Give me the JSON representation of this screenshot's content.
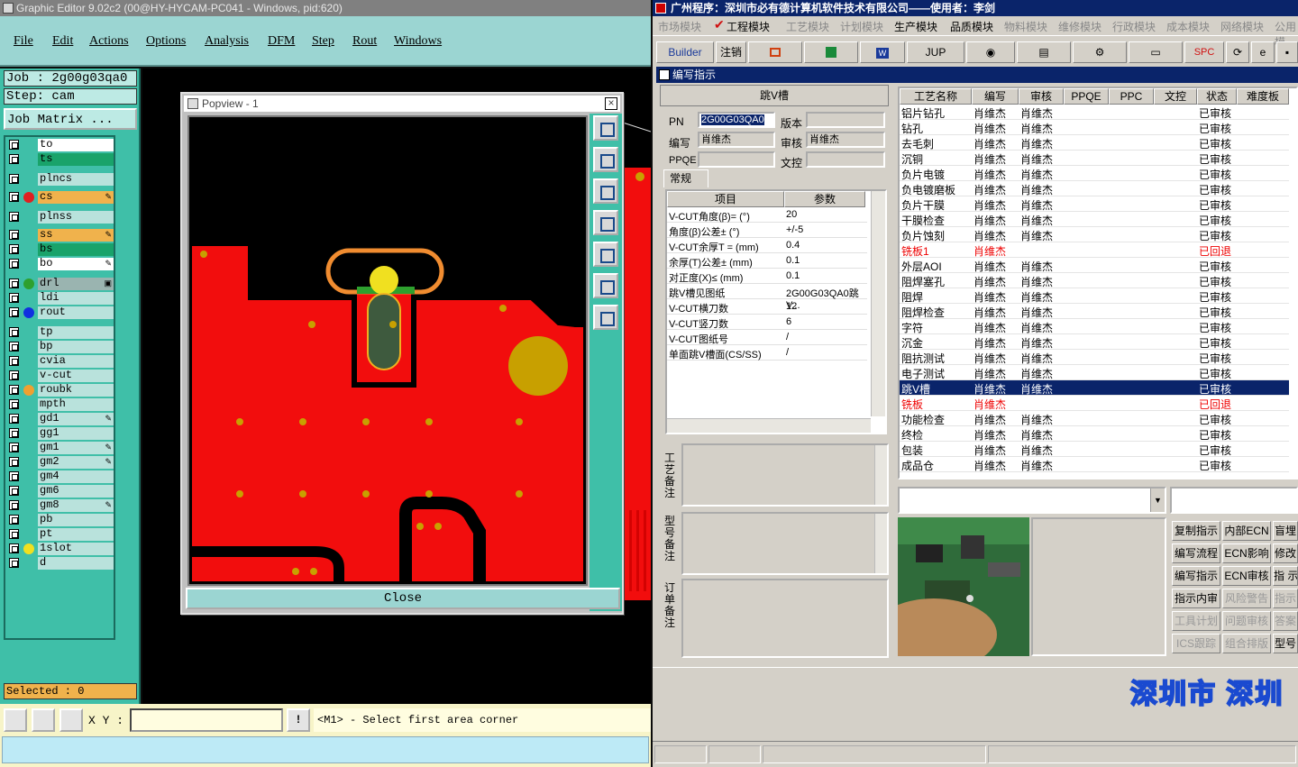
{
  "ge": {
    "title": "Graphic Editor 9.02c2 (00@HY-HYCAM-PC041 - Windows, pid:620)",
    "menu": [
      "File",
      "Edit",
      "Actions",
      "Options",
      "Analysis",
      "DFM",
      "Step",
      "Rout",
      "Windows"
    ],
    "job": "Job : 2g00g03qa0",
    "step": "Step: cam",
    "job_matrix": "Job Matrix ...",
    "layers": [
      {
        "name": "to",
        "bg": "#ffffff",
        "dot": ""
      },
      {
        "name": "ts",
        "bg": "#19a36a",
        "dot": ""
      },
      {
        "name": "plncs",
        "bg": "#b9e2dc",
        "dot": ""
      },
      {
        "name": "cs",
        "bg": "#f0b24c",
        "dot": "#e02020",
        "mark": "✎"
      },
      {
        "name": "plnss",
        "bg": "#b9e2dc",
        "dot": ""
      },
      {
        "name": "ss",
        "bg": "#f0b24c",
        "dot": "",
        "mark": "✎"
      },
      {
        "name": "bs",
        "bg": "#19a36a",
        "dot": ""
      },
      {
        "name": "bo",
        "bg": "#ffffff",
        "dot": "",
        "mark": "✎"
      },
      {
        "name": "drl",
        "bg": "#9ab4b0",
        "dot": "#2ea02e",
        "mark": "▣"
      },
      {
        "name": "ldi",
        "bg": "#b9e2dc",
        "dot": ""
      },
      {
        "name": "rout",
        "bg": "#b9e2dc",
        "dot": "#1030e0"
      },
      {
        "name": "tp",
        "bg": "#b9e2dc",
        "dot": ""
      },
      {
        "name": "bp",
        "bg": "#b9e2dc",
        "dot": ""
      },
      {
        "name": "cvia",
        "bg": "#b9e2dc",
        "dot": ""
      },
      {
        "name": "v-cut",
        "bg": "#b9e2dc",
        "dot": ""
      },
      {
        "name": "roubk",
        "bg": "#b9e2dc",
        "dot": "#f0a030"
      },
      {
        "name": "mpth",
        "bg": "#b9e2dc",
        "dot": ""
      },
      {
        "name": "gd1",
        "bg": "#b9e2dc",
        "dot": "",
        "mark": "✎"
      },
      {
        "name": "gg1",
        "bg": "#b9e2dc",
        "dot": ""
      },
      {
        "name": "gm1",
        "bg": "#b9e2dc",
        "dot": "",
        "mark": "✎"
      },
      {
        "name": "gm2",
        "bg": "#b9e2dc",
        "dot": "",
        "mark": "✎"
      },
      {
        "name": "gm4",
        "bg": "#b9e2dc",
        "dot": ""
      },
      {
        "name": "gm6",
        "bg": "#b9e2dc",
        "dot": ""
      },
      {
        "name": "gm8",
        "bg": "#b9e2dc",
        "dot": "",
        "mark": "✎"
      },
      {
        "name": "pb",
        "bg": "#b9e2dc",
        "dot": ""
      },
      {
        "name": "pt",
        "bg": "#b9e2dc",
        "dot": ""
      },
      {
        "name": "1slot",
        "bg": "#b9e2dc",
        "dot": "#f0e020"
      },
      {
        "name": "d",
        "bg": "#b9e2dc",
        "dot": ""
      }
    ],
    "popview_title": "Popview - 1",
    "close": "Close",
    "selected": "Selected : 0",
    "xy_label": "X Y :",
    "xy_value": "",
    "message": "<M1> - Select first area corner",
    "colors": {
      "copper": "#f20d0d",
      "outline": "#f08c30",
      "slot": "#3e5a3e",
      "pad": "#c8a000"
    }
  },
  "ra": {
    "title": "广州程序：深圳市必有德计算机软件技术有限公司——使用者：李剑",
    "menu": [
      "市场模块",
      "工程模块",
      "工艺模块",
      "计划模块",
      "生产模块",
      "品质模块",
      "物料模块",
      "维修模块",
      "行政模块",
      "成本模块",
      "网络模块",
      "公用模"
    ],
    "active_menu": [
      1,
      4,
      5
    ],
    "toolbar": {
      "builder": "Builder",
      "logout": "注销",
      "jup": "JUP",
      "spc": "SPC"
    },
    "subtitle": "编写指示",
    "section": "跳V槽",
    "form": {
      "pn_label": "PN",
      "pn": "2G00G03QA0",
      "version_label": "版本",
      "version": "",
      "editor_label": "编写",
      "editor": "肖维杰",
      "reviewer_label": "审核",
      "reviewer": "肖维杰",
      "ppqe_label": "PPQE",
      "ppqe": "",
      "wenkong_label": "文控",
      "wenkong": ""
    },
    "tab": "常规",
    "param_headers": [
      "项目",
      "参数"
    ],
    "params": [
      [
        "V-CUT角度(β)=  (°)",
        "20"
      ],
      [
        "角度(β)公差±  (°)",
        "+/-5"
      ],
      [
        "V-CUT余厚T = (mm)",
        "0.4"
      ],
      [
        "余厚(T)公差±  (mm)",
        "0.1"
      ],
      [
        "对正度(X)≤  (mm)",
        "0.1"
      ],
      [
        "跳V槽见图纸",
        "2G00G03QA0跳V..."
      ],
      [
        "V-CUT横刀数",
        "12"
      ],
      [
        "V-CUT竖刀数",
        "6"
      ],
      [
        "V-CUT图纸号",
        "/"
      ],
      [
        "单面跳V槽面(CS/SS)",
        "/"
      ]
    ],
    "remark_labels": [
      "工艺备注",
      "型号备注",
      "订单备注"
    ],
    "grid_headers": [
      "工艺名称",
      "编写",
      "审核",
      "PPQE",
      "PPC",
      "文控",
      "状态",
      "难度板"
    ],
    "grid_rows": [
      [
        "铝片钻孔",
        "肖维杰",
        "肖维杰",
        "",
        "",
        "",
        "已审核",
        ""
      ],
      [
        "钻孔",
        "肖维杰",
        "肖维杰",
        "",
        "",
        "",
        "已审核",
        ""
      ],
      [
        "去毛刺",
        "肖维杰",
        "肖维杰",
        "",
        "",
        "",
        "已审核",
        ""
      ],
      [
        "沉铜",
        "肖维杰",
        "肖维杰",
        "",
        "",
        "",
        "已审核",
        ""
      ],
      [
        "负片电镀",
        "肖维杰",
        "肖维杰",
        "",
        "",
        "",
        "已审核",
        ""
      ],
      [
        "负电镀磨板",
        "肖维杰",
        "肖维杰",
        "",
        "",
        "",
        "已审核",
        ""
      ],
      [
        "负片干膜",
        "肖维杰",
        "肖维杰",
        "",
        "",
        "",
        "已审核",
        ""
      ],
      [
        "干膜检查",
        "肖维杰",
        "肖维杰",
        "",
        "",
        "",
        "已审核",
        ""
      ],
      [
        "负片蚀刻",
        "肖维杰",
        "肖维杰",
        "",
        "",
        "",
        "已审核",
        ""
      ],
      [
        "铣板1",
        "肖维杰",
        "",
        "",
        "",
        "",
        "已回退",
        ""
      ],
      [
        "外层AOI",
        "肖维杰",
        "肖维杰",
        "",
        "",
        "",
        "已审核",
        ""
      ],
      [
        "阻焊塞孔",
        "肖维杰",
        "肖维杰",
        "",
        "",
        "",
        "已审核",
        ""
      ],
      [
        "阻焊",
        "肖维杰",
        "肖维杰",
        "",
        "",
        "",
        "已审核",
        ""
      ],
      [
        "阻焊检查",
        "肖维杰",
        "肖维杰",
        "",
        "",
        "",
        "已审核",
        ""
      ],
      [
        "字符",
        "肖维杰",
        "肖维杰",
        "",
        "",
        "",
        "已审核",
        ""
      ],
      [
        "沉金",
        "肖维杰",
        "肖维杰",
        "",
        "",
        "",
        "已审核",
        ""
      ],
      [
        "阻抗测试",
        "肖维杰",
        "肖维杰",
        "",
        "",
        "",
        "已审核",
        ""
      ],
      [
        "电子测试",
        "肖维杰",
        "肖维杰",
        "",
        "",
        "",
        "已审核",
        ""
      ],
      [
        "跳V槽",
        "肖维杰",
        "肖维杰",
        "",
        "",
        "",
        "已审核",
        ""
      ],
      [
        "铣板",
        "肖维杰",
        "",
        "",
        "",
        "",
        "已回退",
        ""
      ],
      [
        "功能检查",
        "肖维杰",
        "肖维杰",
        "",
        "",
        "",
        "已审核",
        ""
      ],
      [
        "终检",
        "肖维杰",
        "肖维杰",
        "",
        "",
        "",
        "已审核",
        ""
      ],
      [
        "包装",
        "肖维杰",
        "肖维杰",
        "",
        "",
        "",
        "已审核",
        ""
      ],
      [
        "成品仓",
        "肖维杰",
        "肖维杰",
        "",
        "",
        "",
        "已审核",
        ""
      ]
    ],
    "selected_row": 18,
    "red_rows": [
      9,
      19
    ],
    "actions": [
      [
        "复制指示",
        "内部ECN",
        "盲埋"
      ],
      [
        "编写流程",
        "ECN影响",
        "修改"
      ],
      [
        "编写指示",
        "ECN审核",
        "指 示"
      ],
      [
        "指示内审",
        "风险警告",
        "指示"
      ],
      [
        "工具计划",
        "问题审核",
        "答案"
      ],
      [
        "ICS跟踪",
        "组合排版",
        "型号"
      ]
    ],
    "disabled_actions": [
      [
        3,
        1
      ],
      [
        3,
        2
      ],
      [
        4,
        0
      ],
      [
        4,
        1
      ],
      [
        4,
        2
      ],
      [
        5,
        0
      ],
      [
        5,
        1
      ]
    ],
    "banner": "深圳市 深圳"
  }
}
